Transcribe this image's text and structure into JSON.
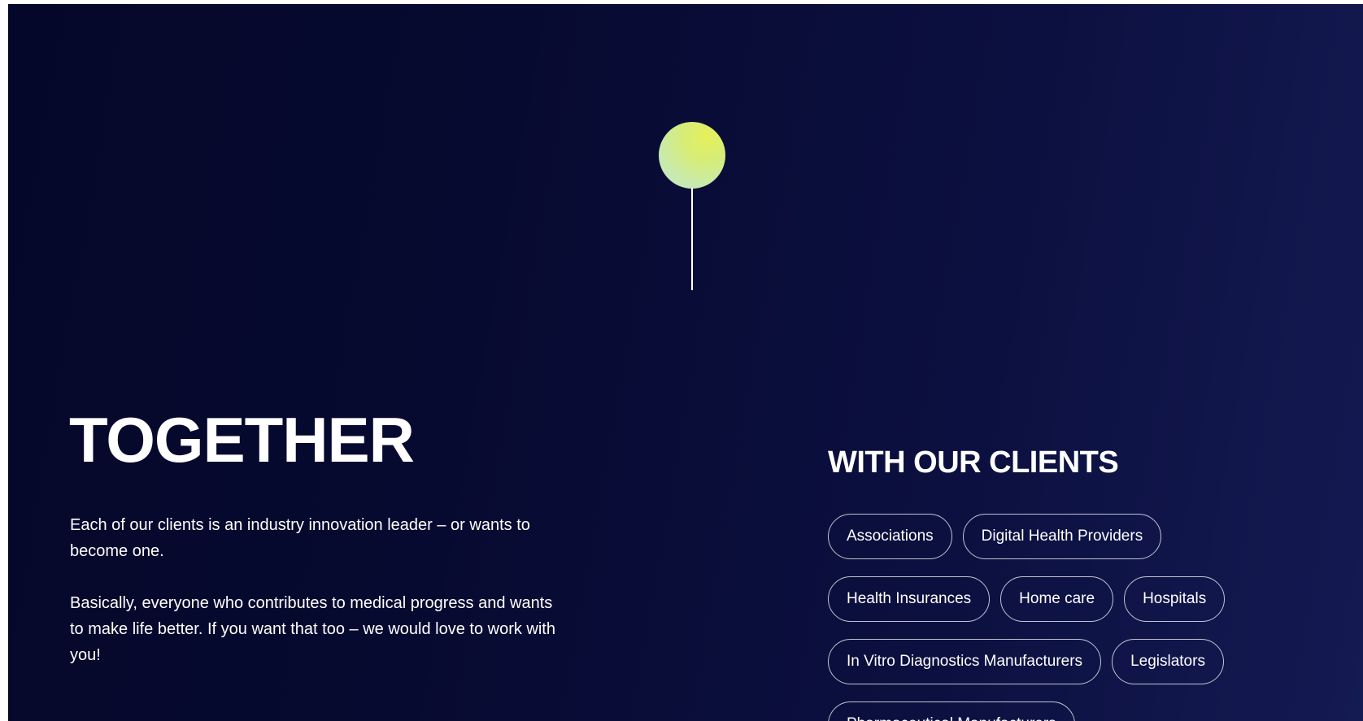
{
  "hero": {
    "pin_color": "#dcee6a"
  },
  "left": {
    "title": "TOGETHER",
    "paragraph_1": "Each of our clients is an industry innovation leader – or wants to become one.",
    "paragraph_2": "Basically, everyone who contributes to medical progress and wants to make life better. If you want that too – we would love to work with you!"
  },
  "right": {
    "title": "WITH OUR CLIENTS",
    "tags": [
      "Associations",
      "Digital Health Providers",
      "Health Insurances",
      "Home care",
      "Hospitals",
      "In Vitro Diagnostics Manufacturers",
      "Legislators",
      "Pharmaceutical Manufacturers"
    ]
  },
  "colors": {
    "background_dark": "#05072a",
    "background_light": "#141a52",
    "text": "#ffffff",
    "accent": "#dcee6a"
  }
}
